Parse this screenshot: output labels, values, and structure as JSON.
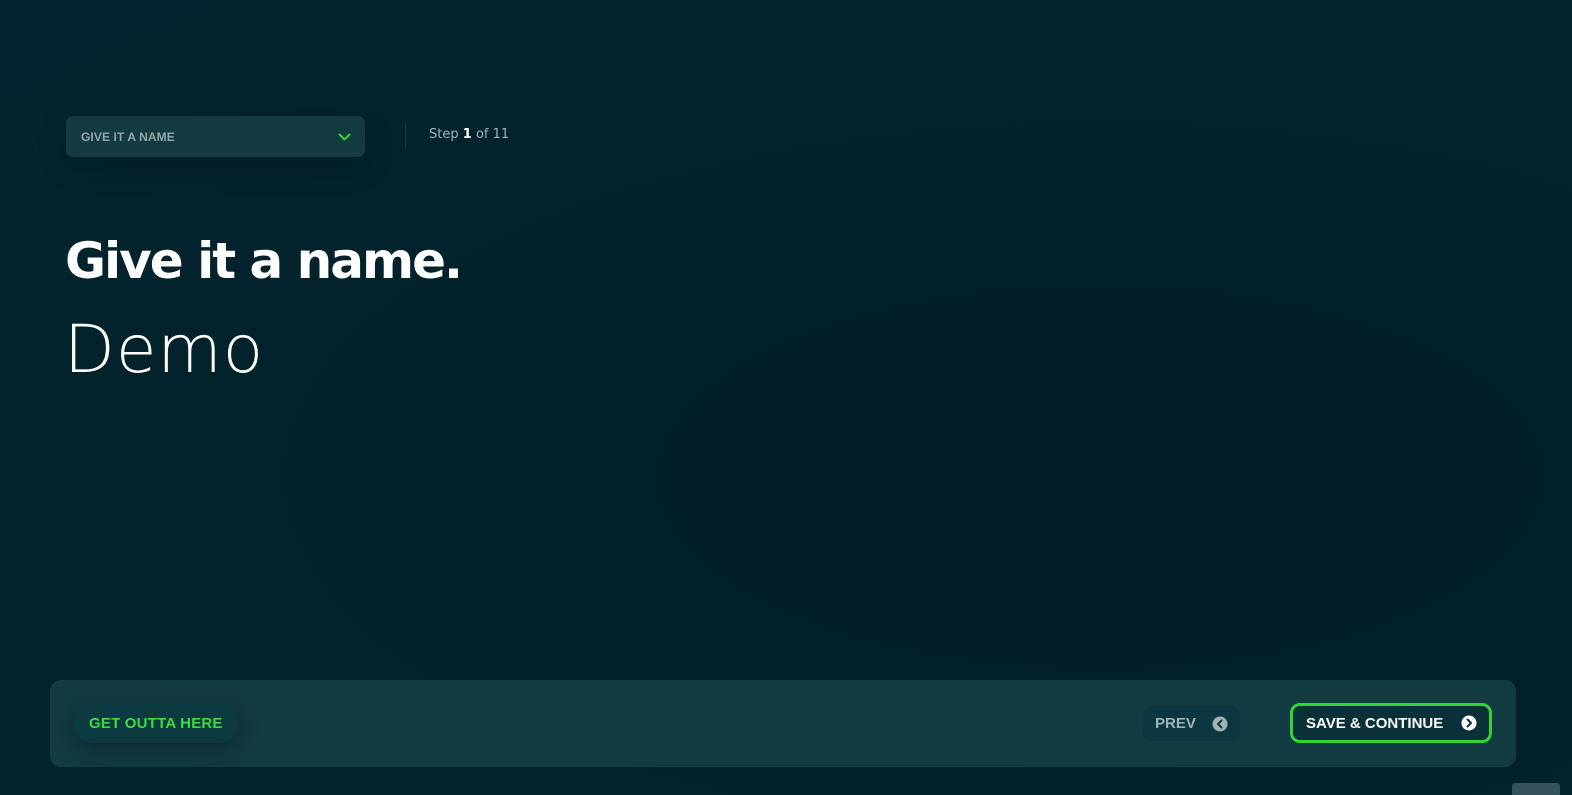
{
  "stepper": {
    "current_step_label": "GIVE IT A NAME",
    "step_prefix": "Step",
    "current_step": "1",
    "step_suffix": "of 11"
  },
  "main": {
    "title": "Give it a name.",
    "name_value": "Demo"
  },
  "actions": {
    "exit_label": "GET OUTTA HERE",
    "prev_label": "PREV",
    "save_label": "SAVE & CONTINUE"
  },
  "icons": {
    "dropdown": "chevron-down-icon",
    "prev": "chevron-left-circle-icon",
    "save": "chevron-right-circle-icon"
  },
  "colors": {
    "background": "#03222b",
    "panel": "#123b42",
    "accent_green": "#35d436",
    "muted_text": "#9fb2b5"
  }
}
